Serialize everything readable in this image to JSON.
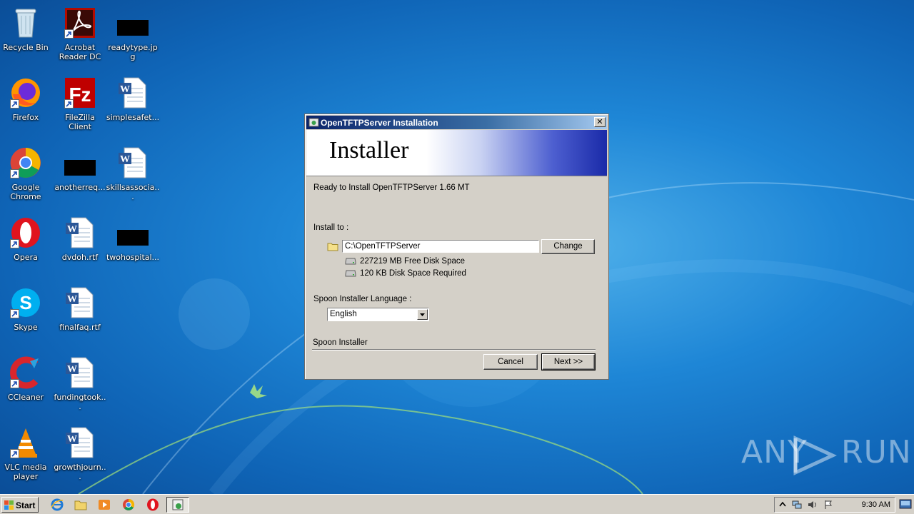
{
  "desktop": {
    "icons": [
      {
        "label": "Recycle Bin",
        "icon": "recycle-bin-icon"
      },
      {
        "label": "Acrobat Reader DC",
        "icon": "acrobat-icon"
      },
      {
        "label": "readytype.jpg",
        "icon": "image-file-icon"
      },
      {
        "label": "Firefox",
        "icon": "firefox-icon"
      },
      {
        "label": "FileZilla Client",
        "icon": "filezilla-icon"
      },
      {
        "label": "simplesafet...",
        "icon": "word-document-icon"
      },
      {
        "label": "Google Chrome",
        "icon": "chrome-icon"
      },
      {
        "label": "anotherreq...",
        "icon": "image-file-icon"
      },
      {
        "label": "skillsassocia...",
        "icon": "word-document-icon"
      },
      {
        "label": "Opera",
        "icon": "opera-icon"
      },
      {
        "label": "dvdoh.rtf",
        "icon": "word-document-icon"
      },
      {
        "label": "twohospital...",
        "icon": "image-file-icon"
      },
      {
        "label": "Skype",
        "icon": "skype-icon"
      },
      {
        "label": "finalfaq.rtf",
        "icon": "word-document-icon"
      },
      {
        "label": "CCleaner",
        "icon": "ccleaner-icon"
      },
      {
        "label": "fundingtook...",
        "icon": "word-document-icon"
      },
      {
        "label": "VLC media player",
        "icon": "vlc-icon"
      },
      {
        "label": "growthjourn...",
        "icon": "word-document-icon"
      }
    ]
  },
  "dialog": {
    "title": "OpenTFTPServer Installation",
    "banner_title": "Installer",
    "ready_text": "Ready to Install OpenTFTPServer 1.66 MT",
    "install_to_label": "Install to :",
    "install_path": "C:\\OpenTFTPServer",
    "change_button": "Change",
    "free_space": "227219 MB Free Disk Space",
    "required_space": "120 KB Disk Space Required",
    "language_label": "Spoon Installer Language :",
    "language_value": "English",
    "footer_label": "Spoon Installer",
    "cancel_button": "Cancel",
    "next_button": "Next >>",
    "close_glyph": "✕"
  },
  "taskbar": {
    "start_label": "Start",
    "clock": "9:30 AM"
  },
  "watermark": {
    "left": "ANY",
    "right": "RUN"
  }
}
